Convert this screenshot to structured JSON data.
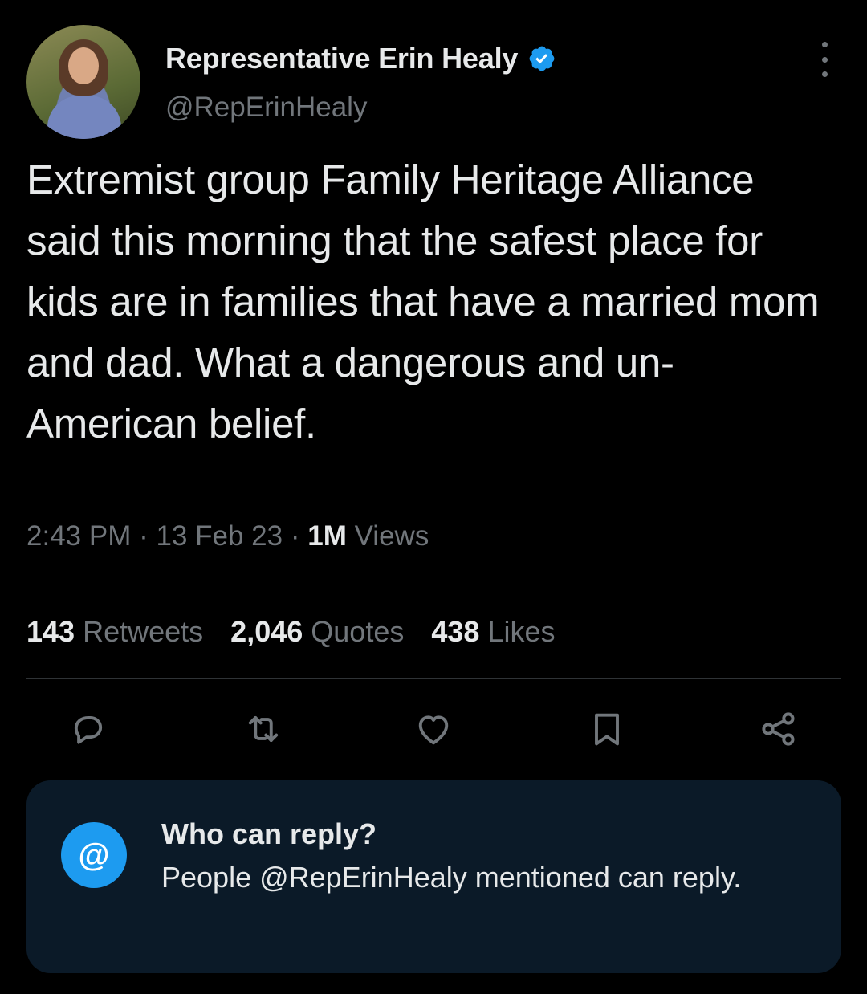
{
  "author": {
    "name": "Representative Erin Healy",
    "handle": "@RepErinHealy",
    "verified": true
  },
  "tweet": {
    "text": "Extremist group Family Heritage Alliance said this morning that the safest place for kids are in families that have a married mom and dad. What a dangerous and un-American belief.",
    "time": "2:43 PM",
    "date": "13 Feb 23",
    "views_count": "1M",
    "views_label": "Views",
    "separator": "·"
  },
  "stats": {
    "retweets_count": "143",
    "retweets_label": "Retweets",
    "quotes_count": "2,046",
    "quotes_label": "Quotes",
    "likes_count": "438",
    "likes_label": "Likes"
  },
  "actions": [
    "reply-icon",
    "retweet-icon",
    "like-icon",
    "bookmark-icon",
    "share-icon"
  ],
  "reply_settings": {
    "icon": "@",
    "title": "Who can reply?",
    "description": "People @RepErinHealy mentioned can reply."
  },
  "colors": {
    "background": "#000000",
    "text": "#e7e9ea",
    "secondary": "#71767b",
    "accent": "#1d9bf0",
    "reply_box": "#0b1a28"
  }
}
